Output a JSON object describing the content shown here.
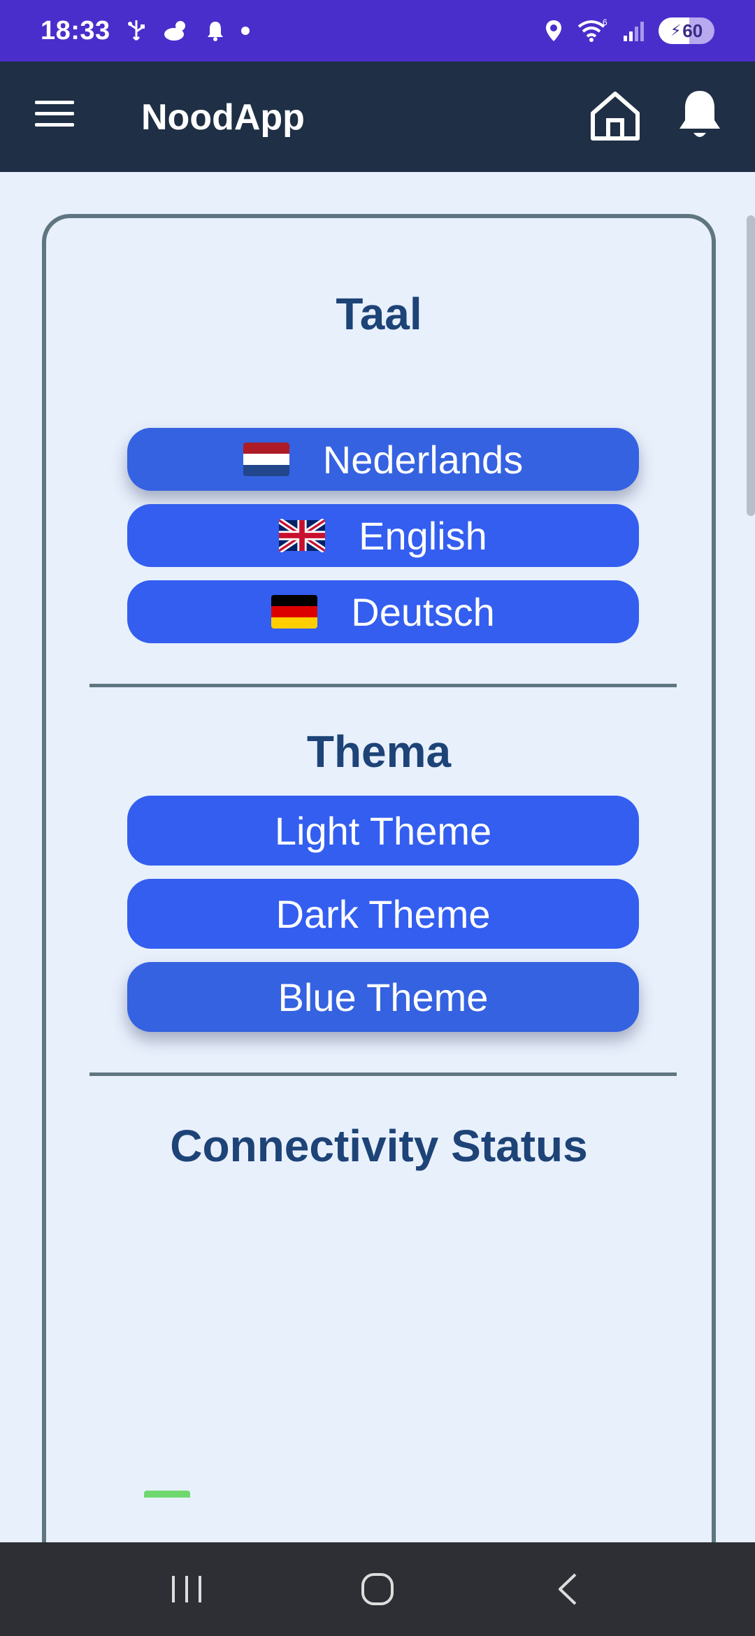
{
  "status_bar": {
    "time": "18:33",
    "battery_level": "60",
    "icons_left": [
      "usb-icon",
      "weather-icon",
      "notification-bell-icon",
      "dot-icon"
    ],
    "icons_right": [
      "location-icon",
      "wifi-icon",
      "signal-icon",
      "battery-icon"
    ]
  },
  "app_bar": {
    "title": "NoodApp",
    "icons": [
      "menu-icon",
      "home-icon",
      "bell-icon"
    ]
  },
  "language": {
    "title": "Taal",
    "options": [
      {
        "label": "Nederlands",
        "flag": "netherlands-flag-icon",
        "selected": true
      },
      {
        "label": "English",
        "flag": "uk-flag-icon",
        "selected": false
      },
      {
        "label": "Deutsch",
        "flag": "germany-flag-icon",
        "selected": false
      }
    ]
  },
  "theme": {
    "title": "Thema",
    "options": [
      {
        "label": "Light Theme",
        "selected": false
      },
      {
        "label": "Dark Theme",
        "selected": false
      },
      {
        "label": "Blue Theme",
        "selected": true
      }
    ]
  },
  "connectivity": {
    "title": "Connectivity Status"
  },
  "colors": {
    "status_bar": "#4a2ecb",
    "app_bar": "#1f2f45",
    "background": "#e8f0fc",
    "button": "#335ef0",
    "heading": "#1d4377",
    "border": "#5f7680",
    "nav_bar": "#2d2f34"
  }
}
